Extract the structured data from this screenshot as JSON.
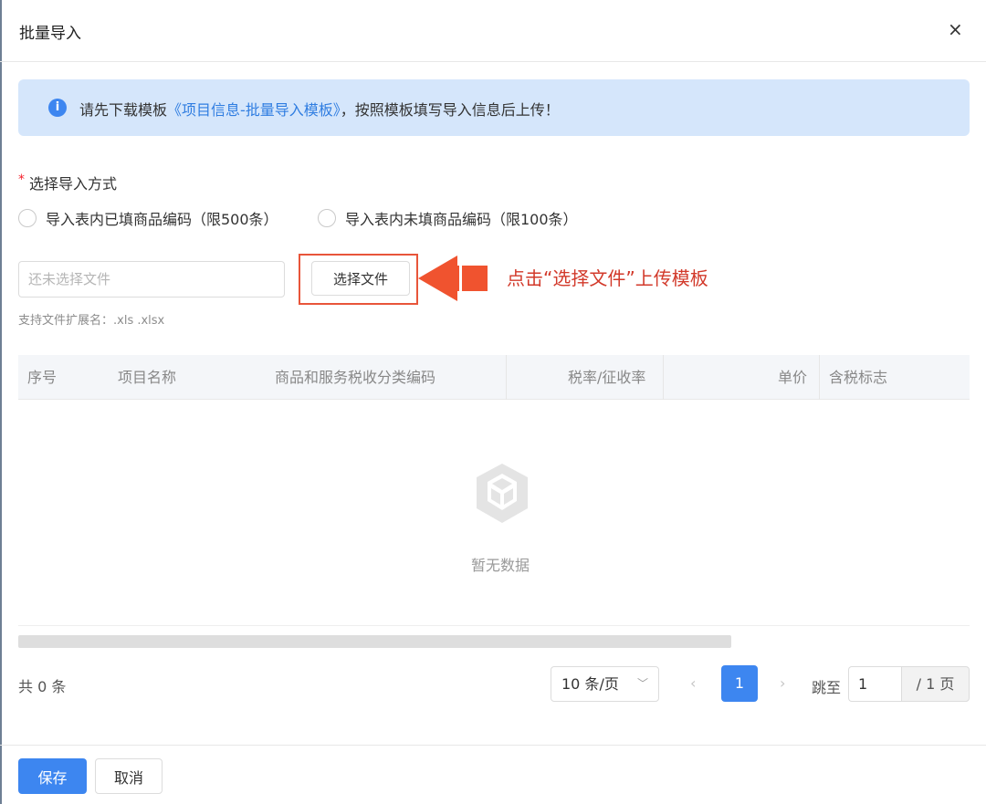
{
  "dialog": {
    "title": "批量导入",
    "close_label": "×"
  },
  "alert": {
    "icon": "info-icon",
    "icon_glyph": "i",
    "text_before": "请先下载模板",
    "link_text": "《项目信息-批量导入模板》",
    "text_after": "，按照模板填写导入信息后上传！"
  },
  "import_method": {
    "required_mark": "*",
    "label": "选择导入方式",
    "options": [
      {
        "label": "导入表内已填商品编码（限500条）",
        "selected": false
      },
      {
        "label": "导入表内未填商品编码（限100条）",
        "selected": false
      }
    ]
  },
  "file_upload": {
    "placeholder": "还未选择文件",
    "value": "",
    "button_label": "选择文件",
    "hint": "支持文件扩展名：.xls .xlsx"
  },
  "annotation": {
    "text": "点击“选择文件”上传模板",
    "color": "#d2392a"
  },
  "table": {
    "columns": [
      "序号",
      "项目名称",
      "商品和服务税收分类编码",
      "税率/征收率",
      "单价",
      "含税标志"
    ],
    "rows": [],
    "empty_text": "暂无数据",
    "empty_icon": "empty-box-icon"
  },
  "pagination": {
    "total_text": "共 0 条",
    "page_size": "10 条/页",
    "prev": "‹",
    "next": "›",
    "current_page": "1",
    "jump_label": "跳至",
    "jump_value": "1",
    "total_pages_text": "/ 1 页"
  },
  "footer": {
    "save_label": "保存",
    "cancel_label": "取消"
  },
  "colors": {
    "primary": "#3d86f0",
    "alert_bg": "#d5e6fb",
    "link": "#2f7de1",
    "required": "#f5222d",
    "highlight": "#e8553a"
  }
}
